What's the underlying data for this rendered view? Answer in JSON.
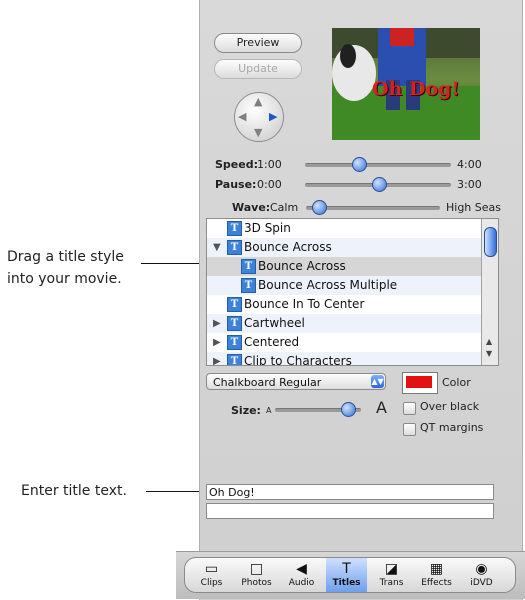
{
  "callouts": {
    "drag_hint_line1": "Drag a title style",
    "drag_hint_line2": "into your movie.",
    "enter_hint": "Enter title text."
  },
  "buttons": {
    "preview": "Preview",
    "update": "Update"
  },
  "preview": {
    "overlay_text": "Oh Dog!"
  },
  "sliders": {
    "speed": {
      "label": "Speed:",
      "min": "1:00",
      "max": "4:00",
      "level": 0.35
    },
    "pause": {
      "label": "Pause:",
      "min": "0:00",
      "max": "3:00",
      "level": 0.5
    },
    "wave": {
      "label": "Wave:",
      "min": "Calm",
      "max": "High Seas",
      "level": 0.05
    }
  },
  "title_list": {
    "items": [
      {
        "label": "3D Spin",
        "indent": 0,
        "disclosure": ""
      },
      {
        "label": "Bounce Across",
        "indent": 0,
        "disclosure": "▼"
      },
      {
        "label": "Bounce Across",
        "indent": 1,
        "disclosure": ""
      },
      {
        "label": "Bounce Across Multiple",
        "indent": 1,
        "disclosure": ""
      },
      {
        "label": "Bounce In To Center",
        "indent": 0,
        "disclosure": ""
      },
      {
        "label": "Cartwheel",
        "indent": 0,
        "disclosure": "▶"
      },
      {
        "label": "Centered",
        "indent": 0,
        "disclosure": "▶"
      },
      {
        "label": "Clip to Characters",
        "indent": 0,
        "disclosure": "▶"
      }
    ],
    "selected_index": 2
  },
  "font": {
    "value": "Chalkboard Regular"
  },
  "color": {
    "label": "Color",
    "swatch": "#e21212"
  },
  "size": {
    "label": "Size:",
    "small_glyph": "A",
    "large_glyph": "A",
    "level": 0.9
  },
  "options": {
    "over_black": "Over black",
    "qt_margins": "QT margins"
  },
  "title_text": {
    "line1": "Oh Dog!",
    "line2": ""
  },
  "tabs": [
    {
      "label": "Clips",
      "icon": "▭"
    },
    {
      "label": "Photos",
      "icon": "□"
    },
    {
      "label": "Audio",
      "icon": "◀"
    },
    {
      "label": "Titles",
      "icon": "T"
    },
    {
      "label": "Trans",
      "icon": "◪"
    },
    {
      "label": "Effects",
      "icon": "▦"
    },
    {
      "label": "iDVD",
      "icon": "◉"
    }
  ],
  "active_tab": "Titles"
}
